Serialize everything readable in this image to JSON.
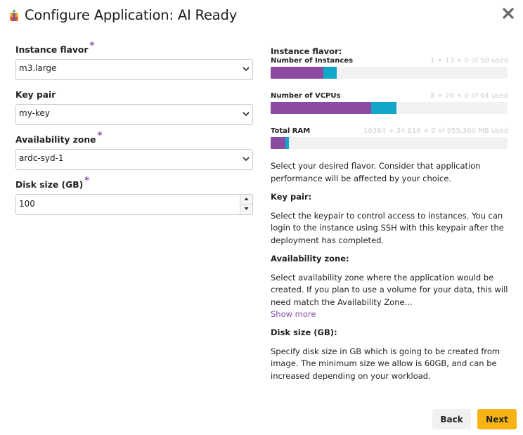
{
  "dialog": {
    "title": "Configure Application: AI Ready",
    "close_icon": "close-icon"
  },
  "form": {
    "required_marker": "*",
    "instance_flavor": {
      "label": "Instance flavor",
      "value": "m3.large"
    },
    "key_pair": {
      "label": "Key pair",
      "value": "my-key"
    },
    "availability_zone": {
      "label": "Availability zone",
      "value": "ardc-syd-1"
    },
    "disk_size": {
      "label": "Disk size (GB)",
      "value": "100"
    }
  },
  "quota": {
    "heading": "Instance flavor:",
    "meters": [
      {
        "name": "Number of Instances",
        "usage_text": "1 + 13 + 0 of 50 used",
        "used": 1,
        "current": 13,
        "requested": 0,
        "limit": 50
      },
      {
        "name": "Number of VCPUs",
        "usage_text": "8 + 26 + 0 of 64 used",
        "used": 8,
        "current": 26,
        "requested": 0,
        "limit": 64
      },
      {
        "name": "Total RAM",
        "usage_text": "16384 + 34,816 + 0 of 655,360 MB used",
        "used": 16384,
        "current": 34816,
        "requested": 0,
        "limit": 655360
      }
    ],
    "colors": {
      "current": "#8b4ba1",
      "added": "#12a6c9",
      "track": "#f2f2f2"
    }
  },
  "help": {
    "flavor_text": "Select your desired flavor. Consider that application performance will be affected by your choice.",
    "key_pair_heading": "Key pair:",
    "key_pair_text": "Select the keypair to control access to instances. You can login to the instance using SSH with this keypair after the deployment has completed.",
    "zone_heading": "Availability zone:",
    "zone_text": "Select availability zone where the application would be created. If you plan to use a volume for your data, this will need match the Availability Zone...",
    "show_more": "Show more",
    "disk_heading": "Disk size (GB):",
    "disk_text": "Specify disk size in GB which is going to be created from image. The minimum size we allow is 60GB, and can be increased depending on your workload."
  },
  "buttons": {
    "back": "Back",
    "next": "Next"
  },
  "colors": {
    "accent": "#8a4ca8",
    "primary_button": "#f7b314"
  }
}
